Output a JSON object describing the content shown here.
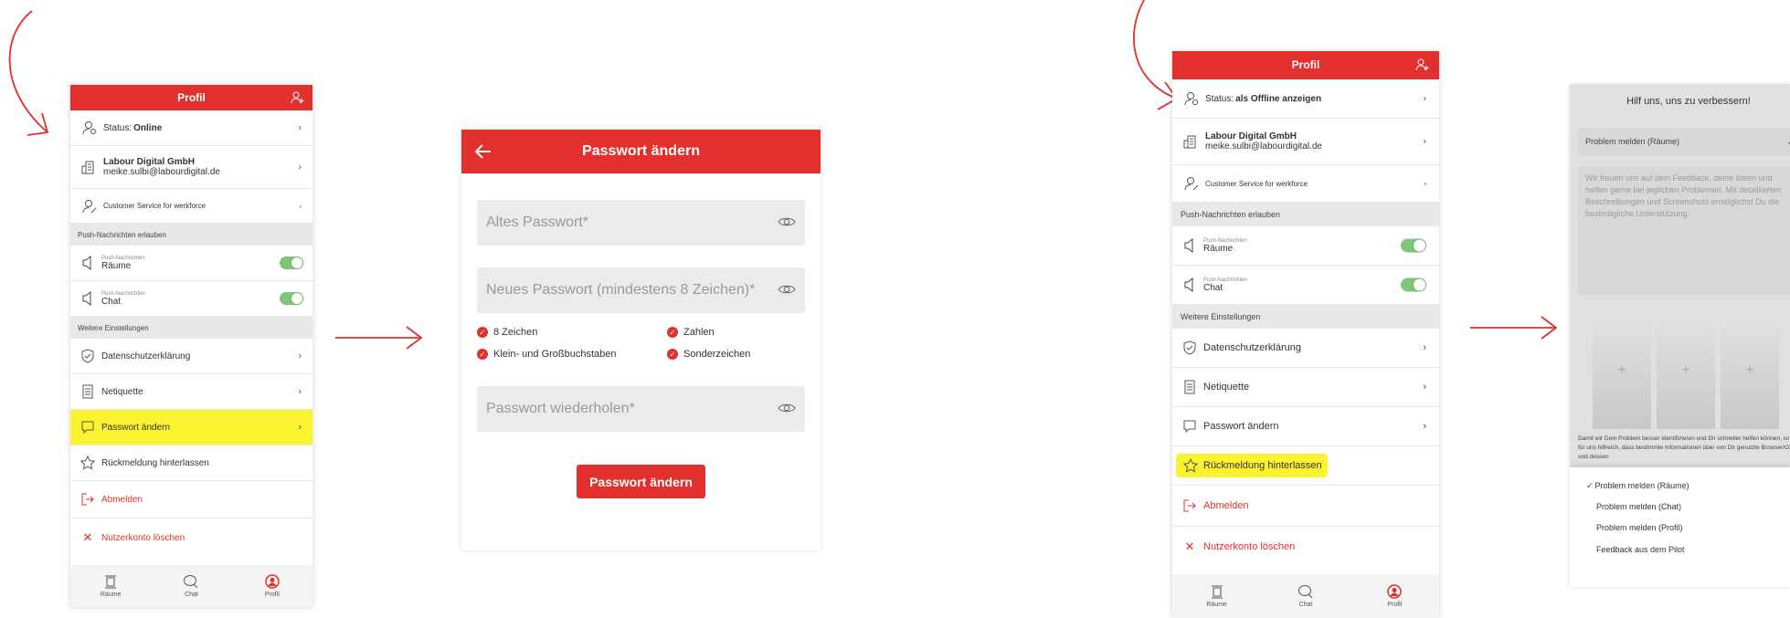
{
  "colors": {
    "accent": "#e1302e",
    "toggle": "#7ec77a",
    "highlight": "#fbf230"
  },
  "screen1": {
    "header_title": "Profil",
    "status_label": "Status: ",
    "status_value": "Online",
    "company_name": "Labour Digital GmbH",
    "company_email": "meike.sulbi@labourdigital.de",
    "customer_service": "Customer Service for werkforce",
    "push_section": "Push-Nachrichten erlauben",
    "push_small": "Push-Nachrichten",
    "push_rooms": "Räume",
    "push_chat": "Chat",
    "more_section": "Weitere Einstellungen",
    "privacy": "Datenschutzerklärung",
    "netiquette": "Netiquette",
    "password": "Passwort ändern",
    "feedback": "Rückmeldung hinterlassen",
    "logout": "Abmelden",
    "delete": "Nutzerkonto löschen",
    "tabs": [
      "Räume",
      "Chat",
      "Profil"
    ]
  },
  "screen2": {
    "header_title": "Passwort ändern",
    "old_pw": "Altes Passwort*",
    "new_pw": "Neues Passwort (mindestens 8 Zeichen)*",
    "rules": [
      "8 Zeichen",
      "Zahlen",
      "Klein- und Großbuchstaben",
      "Sonderzeichen"
    ],
    "repeat_pw": "Passwort wiederholen*",
    "submit": "Passwort ändern"
  },
  "screen3": {
    "header_title": "Profil",
    "status_label": "Status: ",
    "status_value": "als Offline anzeigen",
    "company_name": "Labour Digital GmbH",
    "company_email": "meike.sulbi@labourdigital.de",
    "customer_service": "Customer Service for werkforce",
    "push_section": "Push-Nachrichten erlauben",
    "push_small": "Push-Nachrichten",
    "push_rooms": "Räume",
    "push_chat": "Chat",
    "more_section": "Weitere Einstellungen",
    "privacy": "Datenschutzerklärung",
    "netiquette": "Netiquette",
    "password": "Passwort ändern",
    "feedback": "Rückmeldung hinterlassen",
    "logout": "Abmelden",
    "delete": "Nutzerkonto löschen",
    "tabs": [
      "Räume",
      "Chat",
      "Profil"
    ]
  },
  "screen4": {
    "title": "Hilf uns, uns zu verbessern!",
    "select_value": "Problem melden (Räume)",
    "textarea_placeholder": "Wir freuen uns auf dein Feedback, deine Ideen und helfen gerne bei jeglichen Problemen. Mit detaillierten Beschreibungen und Screenshots ermöglichst Du die bestmögliche Unterstützung.",
    "info_text": "Damit wir Dein Problem besser identifizieren und Dir schneller helfen können, ist es für uns hilfreich, dass bestimmte Informationen über von Dir genutzte Browser/OS und dessen",
    "options": [
      "Problem melden (Räume)",
      "Problem melden (Chat)",
      "Problem melden (Profil)",
      "Feedback aus dem Pilot"
    ],
    "check_mark": "✓"
  }
}
